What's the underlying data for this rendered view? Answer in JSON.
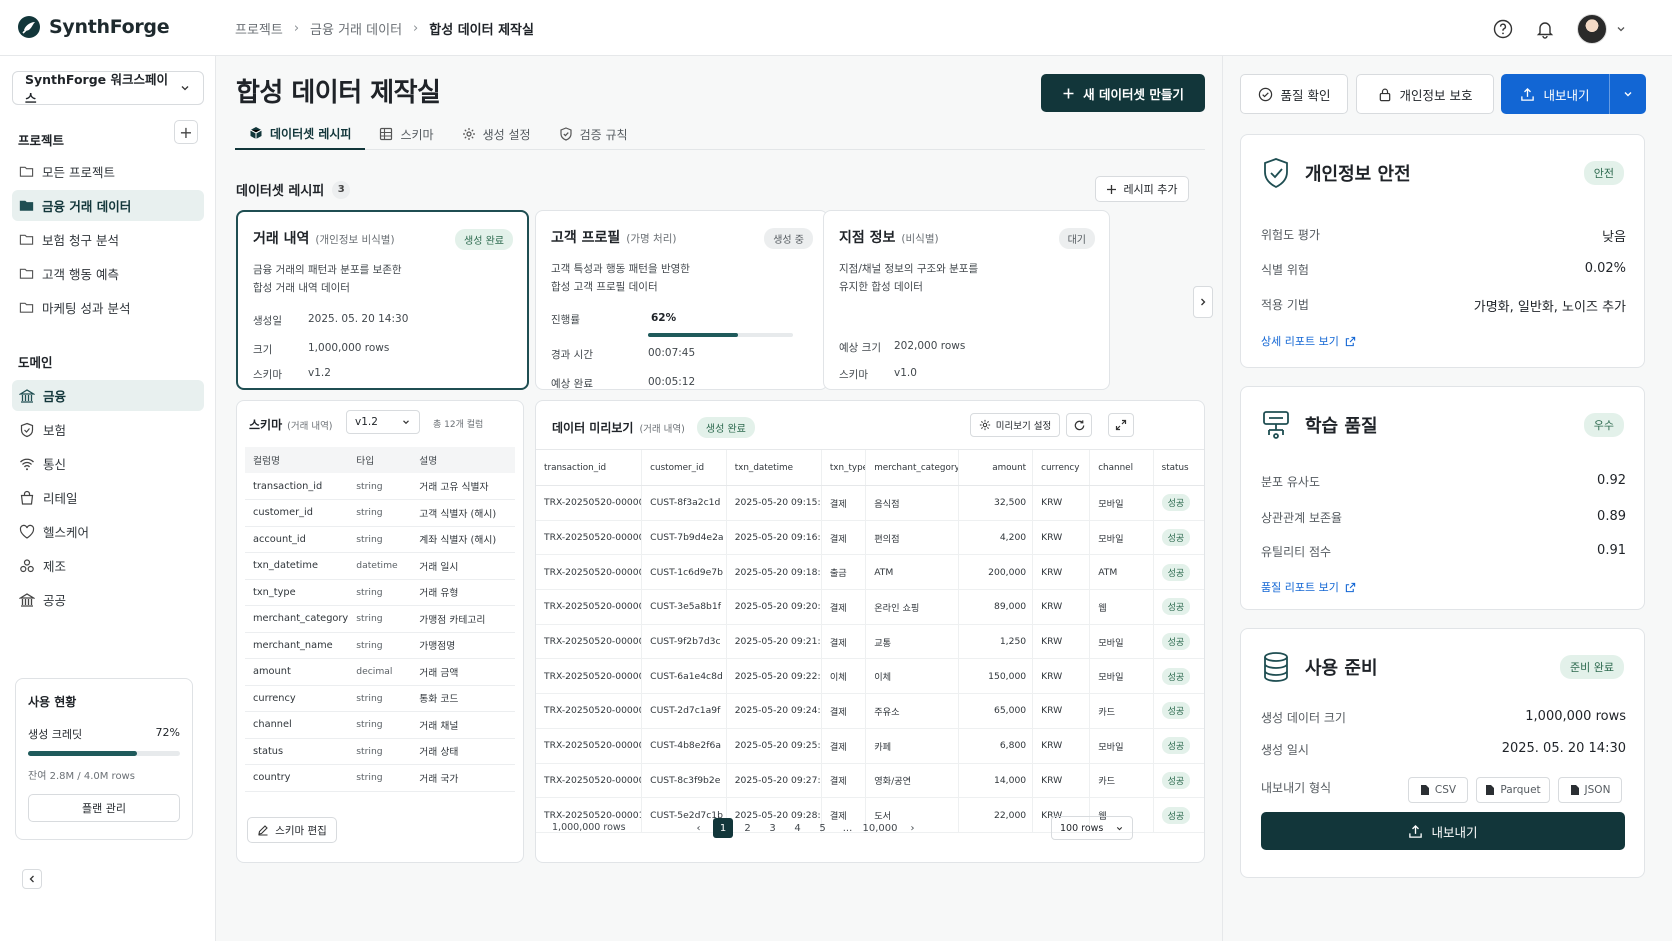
{
  "app": {
    "name": "SynthForge"
  },
  "breadcrumb": [
    "프로젝트",
    "금융 거래 데이터",
    "합성 데이터 제작실"
  ],
  "sidebar": {
    "workspace": "SynthForge 워크스페이스",
    "projects_title": "프로젝트",
    "projects": [
      {
        "label": "모든 프로젝트",
        "icon": "folder-icon"
      },
      {
        "label": "금융 거래 데이터",
        "icon": "folder-open-icon"
      },
      {
        "label": "보험 청구 분석",
        "icon": "folder-icon"
      },
      {
        "label": "고객 행동 예측",
        "icon": "folder-icon"
      },
      {
        "label": "마케팅 성과 분석",
        "icon": "folder-icon"
      }
    ],
    "domains_title": "도메인",
    "domains": [
      {
        "label": "금융",
        "icon": "bank-icon"
      },
      {
        "label": "보험",
        "icon": "shield-icon"
      },
      {
        "label": "통신",
        "icon": "wifi-icon"
      },
      {
        "label": "리테일",
        "icon": "shopping-bag-icon"
      },
      {
        "label": "헬스케어",
        "icon": "heart-icon"
      },
      {
        "label": "제조",
        "icon": "boxes-icon"
      },
      {
        "label": "공공",
        "icon": "government-icon"
      }
    ],
    "usage": {
      "title": "사용 현황",
      "credit_label": "생성 크레딧",
      "credit_percent": "72%",
      "credit_fraction": 0.72,
      "remaining": "잔여 2.8M / 4.0M rows",
      "plan_button": "플랜 관리"
    }
  },
  "main": {
    "title": "합성 데이터 제작실",
    "new_button": "새 데이터셋 만들기",
    "tabs": [
      "데이터셋 레시피",
      "스키마",
      "생성 설정",
      "검증 규칙"
    ],
    "recipes_title": "데이터셋 레시피",
    "recipes_count": "3",
    "add_recipe": "레시피 추가",
    "recipes": [
      {
        "name": "거래 내역",
        "sub": "(개인정보 비식별)",
        "badge": "생성 완료",
        "desc1": "금융 거래의 패턴과 분포를 보존한",
        "desc2": "합성 거래 내역 데이터",
        "k1": "생성일",
        "v1": "2025. 05. 20  14:30",
        "k2": "크기",
        "v2": "1,000,000 rows",
        "k3": "스키마",
        "v3": "v1.2"
      },
      {
        "name": "고객 프로필",
        "sub": "(가명 처리)",
        "badge": "생성 중",
        "desc1": "고객 특성과 행동 패턴을 반영한",
        "desc2": "합성 고객 프로필 데이터",
        "k1": "진행률",
        "v1": "62%",
        "progress": 0.62,
        "k2": "경과 시간",
        "v2": "00:07:45",
        "k3": "예상 완료",
        "v3": "00:05:12"
      },
      {
        "name": "지점 정보",
        "sub": "(비식별)",
        "badge": "대기",
        "desc1": "지점/채널 정보의 구조와 분포를",
        "desc2": "유지한 합성 데이터",
        "k2": "예상 크기",
        "v2": "202,000 rows",
        "k3": "스키마",
        "v3": "v1.0"
      }
    ],
    "schema": {
      "title": "스키마",
      "sub": "(거래 내역)",
      "version": "v1.2",
      "total": "총 12개 컬럼",
      "headers": [
        "컬럼명",
        "타입",
        "설명"
      ],
      "rows": [
        [
          "transaction_id",
          "string",
          "거래 고유 식별자"
        ],
        [
          "customer_id",
          "string",
          "고객 식별자 (해시)"
        ],
        [
          "account_id",
          "string",
          "계좌 식별자 (해시)"
        ],
        [
          "txn_datetime",
          "datetime",
          "거래 일시"
        ],
        [
          "txn_type",
          "string",
          "거래 유형"
        ],
        [
          "merchant_category",
          "string",
          "가맹점 카테고리"
        ],
        [
          "merchant_name",
          "string",
          "가맹점명"
        ],
        [
          "amount",
          "decimal",
          "거래 금액"
        ],
        [
          "currency",
          "string",
          "통화 코드"
        ],
        [
          "channel",
          "string",
          "거래 채널"
        ],
        [
          "status",
          "string",
          "거래 상태"
        ],
        [
          "country",
          "string",
          "거래 국가"
        ]
      ],
      "edit_button": "스키마 편집"
    },
    "preview": {
      "title": "데이터 미리보기",
      "sub": "(거래 내역)",
      "badge": "생성 완료",
      "settings": "미리보기 설정",
      "headers": [
        "transaction_id",
        "customer_id",
        "txn_datetime",
        "txn_type",
        "merchant_category",
        "amount",
        "currency",
        "channel",
        "status"
      ],
      "rows": [
        [
          "TRX-20250520-000001",
          "CUST-8f3a2c1d",
          "2025-05-20 09:15:42",
          "결제",
          "음식점",
          "32,500",
          "KRW",
          "모바일",
          "성공"
        ],
        [
          "TRX-20250520-000002",
          "CUST-7b9d4e2a",
          "2025-05-20 09:16:18",
          "결제",
          "편의점",
          "4,200",
          "KRW",
          "모바일",
          "성공"
        ],
        [
          "TRX-20250520-000003",
          "CUST-1c6d9e7b",
          "2025-05-20 09:18:03",
          "출금",
          "ATM",
          "200,000",
          "KRW",
          "ATM",
          "성공"
        ],
        [
          "TRX-20250520-000004",
          "CUST-3e5a8b1f",
          "2025-05-20 09:20:11",
          "결제",
          "온라인 쇼핑",
          "89,000",
          "KRW",
          "웹",
          "성공"
        ],
        [
          "TRX-20250520-000005",
          "CUST-9f2b7d3c",
          "2025-05-20 09:21:37",
          "결제",
          "교통",
          "1,250",
          "KRW",
          "모바일",
          "성공"
        ],
        [
          "TRX-20250520-000006",
          "CUST-6a1e4c8d",
          "2025-05-20 09:22:52",
          "이체",
          "이체",
          "150,000",
          "KRW",
          "모바일",
          "성공"
        ],
        [
          "TRX-20250520-000007",
          "CUST-2d7c1a9f",
          "2025-05-20 09:24:33",
          "결제",
          "주유소",
          "65,000",
          "KRW",
          "카드",
          "성공"
        ],
        [
          "TRX-20250520-000008",
          "CUST-4b8e2f6a",
          "2025-05-20 09:25:41",
          "결제",
          "카페",
          "6,800",
          "KRW",
          "모바일",
          "성공"
        ],
        [
          "TRX-20250520-000009",
          "CUST-8c3f9b2e",
          "2025-05-20 09:27:05",
          "결제",
          "영화/공연",
          "14,000",
          "KRW",
          "카드",
          "성공"
        ],
        [
          "TRX-20250520-000010",
          "CUST-5e2d7c1b",
          "2025-05-20 09:28:26",
          "결제",
          "도서",
          "22,000",
          "KRW",
          "웹",
          "성공"
        ]
      ],
      "total_rows": "1,000,000 rows",
      "pages": [
        "1",
        "2",
        "3",
        "4",
        "5",
        "...",
        "10,000"
      ],
      "rows_per_page": "100 rows"
    }
  },
  "right": {
    "quality_button": "품질 확인",
    "privacy_button": "개인정보 보호",
    "export_button": "내보내기",
    "privacy": {
      "title": "개인정보 안전",
      "badge": "안전",
      "rows": [
        [
          "위험도 평가",
          "낮음"
        ],
        [
          "식별 위험",
          "0.02%"
        ],
        [
          "적용 기법",
          "가명화, 일반화, 노이즈 추가"
        ]
      ],
      "link": "상세 리포트 보기"
    },
    "quality": {
      "title": "학습 품질",
      "badge": "우수",
      "rows": [
        [
          "분포 유사도",
          "0.92"
        ],
        [
          "상관관계 보존율",
          "0.89"
        ],
        [
          "유틸리티 점수",
          "0.91"
        ]
      ],
      "link": "품질 리포트 보기"
    },
    "ready": {
      "title": "사용 준비",
      "badge": "준비 완료",
      "rows": [
        [
          "생성 데이터 크기",
          "1,000,000 rows"
        ],
        [
          "생성 일시",
          "2025. 05. 20  14:30"
        ]
      ],
      "format_label": "내보내기 형식",
      "formats": [
        "CSV",
        "Parquet",
        "JSON"
      ],
      "export_button": "내보내기"
    }
  },
  "colors": {
    "accent": "#12363a",
    "primary_blue": "#1266d4",
    "success_bg": "#e3f1ea",
    "success_text": "#2d6a4f"
  }
}
